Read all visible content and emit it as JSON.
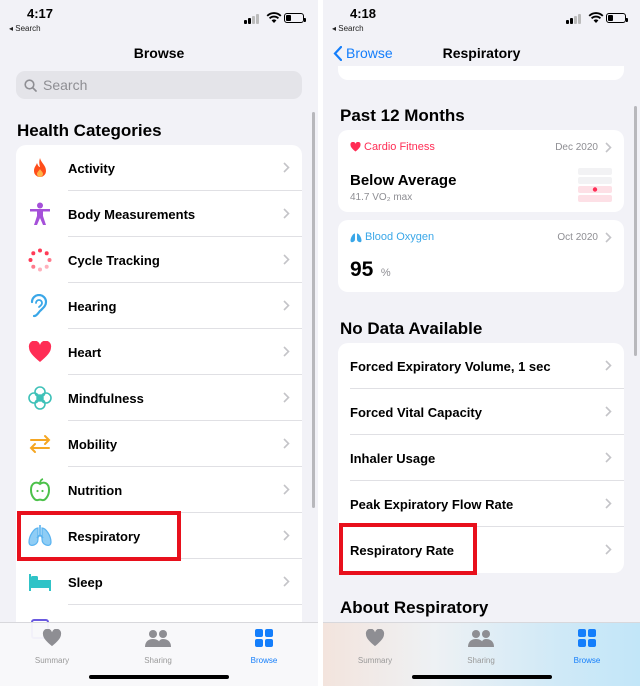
{
  "left": {
    "status": {
      "time": "4:17",
      "back": "◂ Search"
    },
    "nav": {
      "title": "Browse"
    },
    "search": {
      "placeholder": "Search"
    },
    "section_title": "Health Categories",
    "categories": [
      {
        "label": "Activity",
        "icon": "flame-icon",
        "color": "#ff4d1a"
      },
      {
        "label": "Body Measurements",
        "icon": "person-icon",
        "color": "#a550d9"
      },
      {
        "label": "Cycle Tracking",
        "icon": "cycle-icon",
        "color": "#ff3b57"
      },
      {
        "label": "Hearing",
        "icon": "ear-icon",
        "color": "#3aa7e8"
      },
      {
        "label": "Heart",
        "icon": "heart-icon",
        "color": "#ff2d55"
      },
      {
        "label": "Mindfulness",
        "icon": "flower-icon",
        "color": "#3ec1b8"
      },
      {
        "label": "Mobility",
        "icon": "arrows-icon",
        "color": "#f5a623"
      },
      {
        "label": "Nutrition",
        "icon": "apple-icon",
        "color": "#4cc14a"
      },
      {
        "label": "Respiratory",
        "icon": "lungs-icon",
        "color": "#5ab3f0"
      },
      {
        "label": "Sleep",
        "icon": "bed-icon",
        "color": "#30c3c7"
      }
    ]
  },
  "right": {
    "status": {
      "time": "4:18",
      "back": "◂ Search"
    },
    "nav": {
      "back": "Browse",
      "title": "Respiratory"
    },
    "past_title": "Past 12 Months",
    "cardio": {
      "name": "Cardio Fitness",
      "date": "Dec 2020",
      "value": "Below Average",
      "sub": "41.7 VO₂ max",
      "color": "#ff2d55"
    },
    "oxygen": {
      "name": "Blood Oxygen",
      "date": "Oct 2020",
      "value": "95",
      "unit": "%",
      "color": "#3aa7e8"
    },
    "nodata_title": "No Data Available",
    "nodata": [
      "Forced Expiratory Volume, 1 sec",
      "Forced Vital Capacity",
      "Inhaler Usage",
      "Peak Expiratory Flow Rate",
      "Respiratory Rate"
    ],
    "about_title": "About Respiratory"
  },
  "tabs": [
    {
      "label": "Summary",
      "icon": "heart-icon"
    },
    {
      "label": "Sharing",
      "icon": "people-icon"
    },
    {
      "label": "Browse",
      "icon": "grid-icon"
    }
  ],
  "accent": "#147efb",
  "highlight": "#e8101c"
}
